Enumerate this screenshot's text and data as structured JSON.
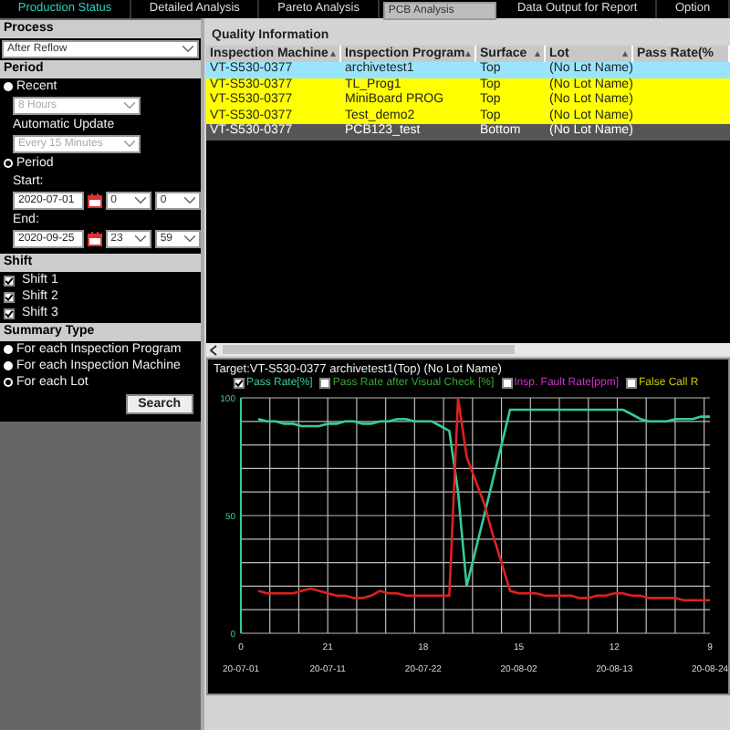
{
  "tabs": [
    {
      "label": "Production Status",
      "selected": false,
      "highlighted": true
    },
    {
      "label": "Detailed Analysis",
      "selected": false,
      "highlighted": false
    },
    {
      "label": "Pareto Analysis",
      "selected": false,
      "highlighted": false
    },
    {
      "label": "PCB Analysis",
      "selected": true,
      "highlighted": false
    },
    {
      "label": "Data Output for Report",
      "selected": false,
      "highlighted": false
    },
    {
      "label": "Option",
      "selected": false,
      "highlighted": false
    }
  ],
  "filter_panel": {
    "process": {
      "header": "Process",
      "value": "After Reflow"
    },
    "period": {
      "header": "Period",
      "recent": {
        "label": "Recent",
        "selected": false,
        "duration": "8 Hours",
        "auto_update_label": "Automatic Update",
        "auto_update": "Every 15 Minutes"
      },
      "range": {
        "label": "Period",
        "selected": true,
        "start_label": "Start:",
        "start_date": "2020-07-01",
        "start_hour": "0",
        "start_minute": "0",
        "end_label": "End:",
        "end_date": "2020-09-25",
        "end_hour": "23",
        "end_minute": "59"
      }
    },
    "shift": {
      "header": "Shift",
      "items": [
        {
          "label": "Shift 1",
          "checked": true
        },
        {
          "label": "Shift 2",
          "checked": true
        },
        {
          "label": "Shift 3",
          "checked": true
        }
      ]
    },
    "summary_type": {
      "header": "Summary Type",
      "options": [
        {
          "label": "For each Inspection Program",
          "selected": false
        },
        {
          "label": "For each Inspection Machine",
          "selected": false
        },
        {
          "label": "For each Lot",
          "selected": true
        }
      ]
    },
    "search_button": "Search"
  },
  "quality": {
    "title": "Quality Information",
    "columns": [
      "Inspection Machine",
      "Inspection Program",
      "Surface",
      "Lot",
      "Pass Rate(%"
    ],
    "rows": [
      {
        "color": "#99e5ff",
        "cells": [
          "VT-S530-0377",
          "archivetest1",
          "Top",
          "(No Lot Name)"
        ]
      },
      {
        "color": "#ffff00",
        "cells": [
          "VT-S530-0377",
          "TL_Prog1",
          "Top",
          "(No Lot Name)"
        ]
      },
      {
        "color": "#ffff00",
        "cells": [
          "VT-S530-0377",
          "MiniBoard PROG",
          "Top",
          "(No Lot Name)"
        ]
      },
      {
        "color": "#ffff00",
        "cells": [
          "VT-S530-0377",
          "Test_demo2",
          "Top",
          "(No Lot Name)"
        ]
      },
      {
        "color": "#555555",
        "cells": [
          "VT-S530-0377",
          "PCB123_test",
          "Bottom",
          "(No Lot Name)"
        ]
      }
    ]
  },
  "chart": {
    "target": "Target:VT-S530-0377 archivetest1(Top) (No Lot Name)",
    "legend": [
      {
        "label": "Pass Rate[%]",
        "checked": true,
        "color": "#33cc99"
      },
      {
        "label": "Pass Rate after Visual Check [%]",
        "checked": false,
        "color": "#33aa33"
      },
      {
        "label": "Insp. Fault Rate[ppm]",
        "checked": false,
        "color": "#cc33cc"
      },
      {
        "label": "False Call R",
        "checked": false,
        "color": "#cccc00"
      }
    ],
    "x_tick_labels": [
      "0",
      "21",
      "18",
      "15",
      "12",
      "9"
    ],
    "chart_data": {
      "type": "line",
      "categories": [
        "20-07-01",
        null,
        null,
        null,
        null,
        null,
        null,
        null,
        null,
        null,
        "20-07-11",
        null,
        null,
        null,
        null,
        null,
        null,
        null,
        null,
        null,
        null,
        "20-07-22",
        null,
        null,
        null,
        null,
        null,
        null,
        null,
        null,
        null,
        null,
        "20-08-02",
        null,
        null,
        null,
        null,
        null,
        null,
        null,
        null,
        null,
        null,
        "20-08-13",
        null,
        null,
        null,
        null,
        null,
        null,
        null,
        null,
        null,
        null,
        "20-08-24"
      ],
      "series": [
        {
          "color": "#33cc99",
          "values": [
            null,
            null,
            91,
            90,
            90,
            89,
            89,
            88,
            88,
            88,
            89,
            89,
            90,
            90,
            89,
            89,
            90,
            90,
            91,
            91,
            90,
            90,
            90,
            88,
            86,
            60,
            20,
            35,
            50,
            65,
            80,
            95,
            95,
            95,
            95,
            95,
            95,
            95,
            95,
            95,
            95,
            95,
            95,
            95,
            95,
            93,
            91,
            90,
            90,
            90,
            91,
            91,
            91,
            92,
            92
          ]
        },
        {
          "color": "#e02020",
          "values": [
            null,
            null,
            18,
            17,
            17,
            17,
            17,
            18,
            19,
            18,
            17,
            16,
            16,
            15,
            15,
            16,
            18,
            17,
            17,
            16,
            16,
            16,
            16,
            16,
            16,
            100,
            75,
            65,
            55,
            42,
            30,
            18,
            17,
            17,
            17,
            16,
            16,
            16,
            16,
            15,
            15,
            16,
            16,
            17,
            17,
            16,
            16,
            15,
            15,
            15,
            15,
            14,
            14,
            14,
            14
          ]
        }
      ],
      "ylim": [
        0,
        100
      ],
      "yticks": [
        0,
        50,
        100
      ]
    }
  }
}
